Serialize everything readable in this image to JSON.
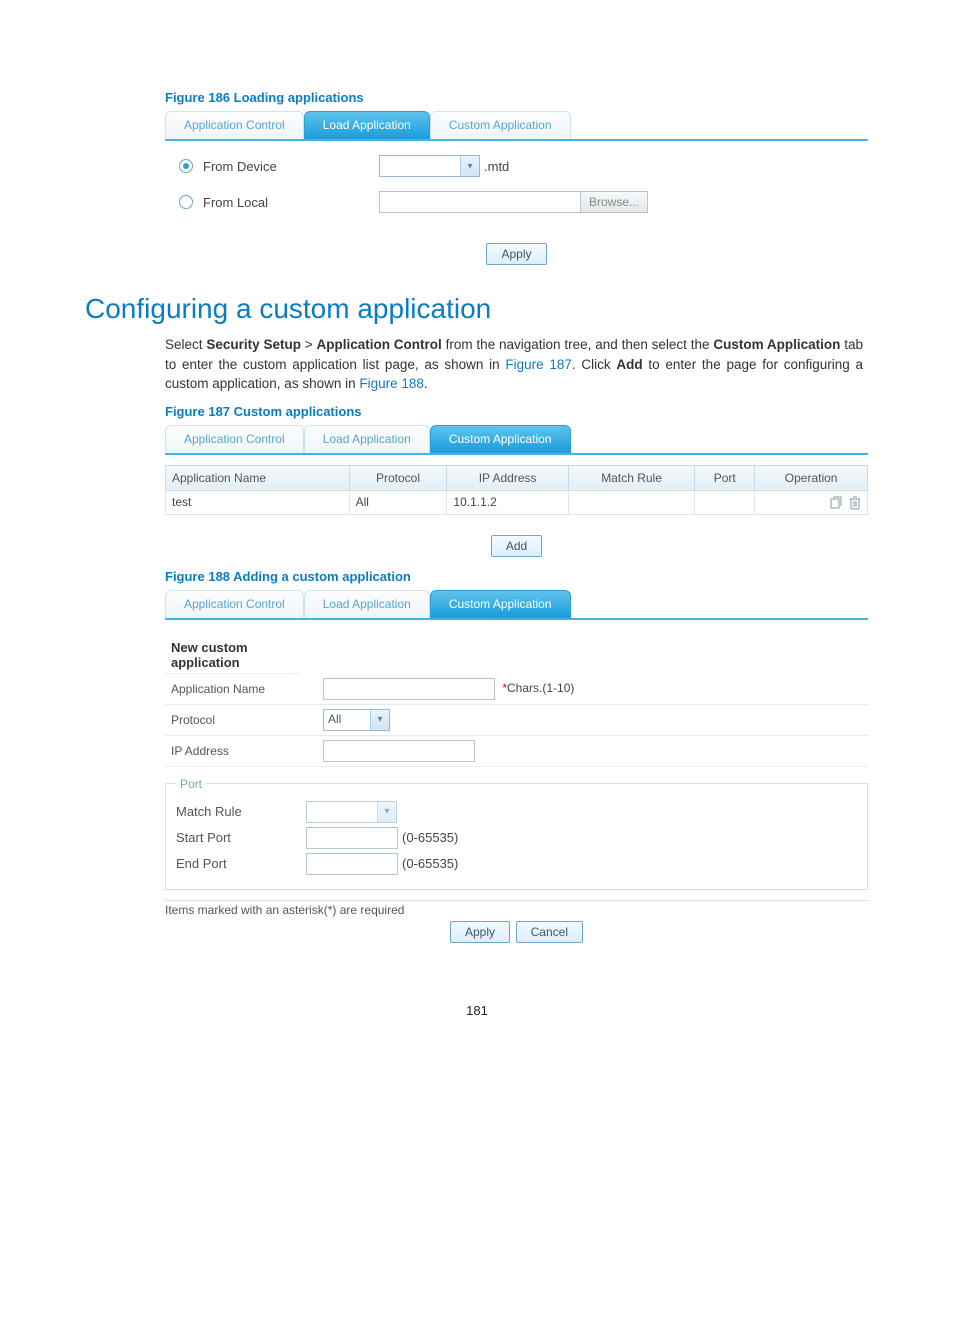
{
  "figure186": {
    "caption": "Figure 186 Loading applications",
    "tabs": [
      "Application Control",
      "Load Application",
      "Custom Application"
    ],
    "active_tab_index": 1,
    "radio1_label": "From Device",
    "radio2_label": "From Local",
    "mtd_suffix": ".mtd",
    "browse_label": "Browse...",
    "apply_label": "Apply"
  },
  "section_heading": "Configuring a custom application",
  "paragraph": {
    "p1a": "Select ",
    "p1b": "Security Setup",
    "p1c": " > ",
    "p1d": "Application Control",
    "p1e": " from the navigation tree, and then select the ",
    "p1f": "Custom Application",
    "p1g": " tab to enter the custom application list page, as shown in ",
    "link1": "Figure 187",
    "p1h": ". Click ",
    "p1i": "Add",
    "p1j": " to enter the page for configuring a custom application, as shown in ",
    "link2": "Figure 188",
    "p1k": "."
  },
  "figure187": {
    "caption": "Figure 187 Custom applications",
    "tabs": [
      "Application Control",
      "Load Application",
      "Custom Application"
    ],
    "active_tab_index": 2,
    "columns": [
      "Application Name",
      "Protocol",
      "IP Address",
      "Match Rule",
      "Port",
      "Operation"
    ],
    "row": {
      "app_name": "test",
      "protocol": "All",
      "ip": "10.1.1.2",
      "match_rule": "",
      "port": ""
    },
    "add_label": "Add"
  },
  "figure188": {
    "caption": "Figure 188 Adding a custom application",
    "tabs": [
      "Application Control",
      "Load Application",
      "Custom Application"
    ],
    "active_tab_index": 2,
    "form_heading": "New custom application",
    "app_name_label": "Application Name",
    "app_name_hint": "Chars.(1-10)",
    "protocol_label": "Protocol",
    "protocol_value": "All",
    "ip_label": "IP Address",
    "port_legend": "Port",
    "match_rule_label": "Match Rule",
    "start_port_label": "Start Port",
    "end_port_label": "End Port",
    "range_hint": "(0-65535)",
    "footnote": "Items marked with an asterisk(*) are required",
    "apply_label": "Apply",
    "cancel_label": "Cancel"
  },
  "page_number": "181"
}
